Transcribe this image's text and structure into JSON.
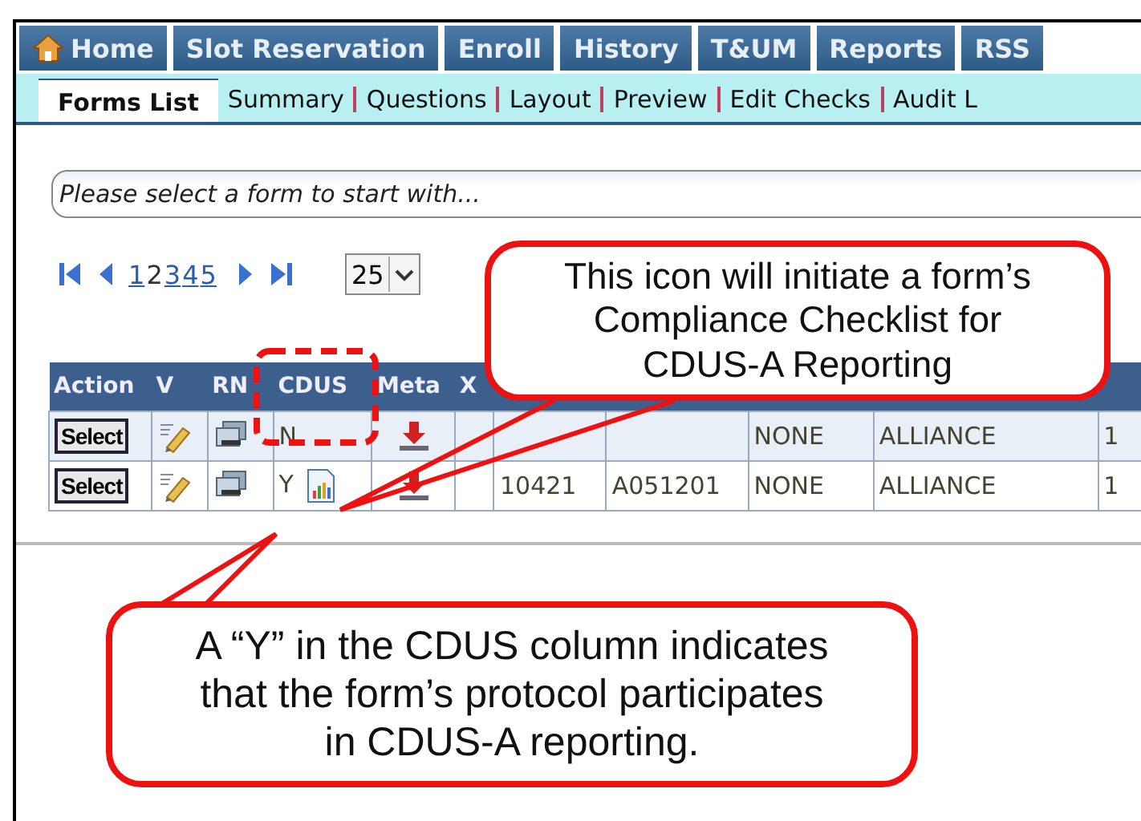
{
  "nav": {
    "tabs": [
      {
        "label": "Home",
        "kind": "home"
      },
      {
        "label": "Slot Reservation",
        "kind": "link"
      },
      {
        "label": "Enroll",
        "kind": "link"
      },
      {
        "label": "History",
        "kind": "link"
      },
      {
        "label": "T&UM",
        "kind": "link"
      },
      {
        "label": "Reports",
        "kind": "link"
      },
      {
        "label": "RSS",
        "kind": "link"
      }
    ]
  },
  "subtabs": [
    {
      "label": "Forms List",
      "selected": true
    },
    {
      "label": "Summary",
      "selected": false
    },
    {
      "label": "Questions",
      "selected": false
    },
    {
      "label": "Layout",
      "selected": false
    },
    {
      "label": "Preview",
      "selected": false
    },
    {
      "label": "Edit Checks",
      "selected": false
    },
    {
      "label": "Audit L",
      "selected": false
    }
  ],
  "search": {
    "placeholder": "Please select a form to start with..."
  },
  "pager": {
    "pages": [
      {
        "label": "1",
        "selected": false
      },
      {
        "label": "2",
        "selected": true
      },
      {
        "label": "3",
        "selected": false
      },
      {
        "label": "4",
        "selected": false
      },
      {
        "label": "5",
        "selected": false
      }
    ],
    "page_size": "25"
  },
  "table": {
    "columns": [
      "Action",
      "V",
      "RN",
      "CDUS",
      "Meta",
      "X"
    ],
    "rows": [
      {
        "action": "Select",
        "cdus": "N",
        "checklist": false,
        "cells": [
          "NONE",
          "ALLIANCE",
          "1"
        ]
      },
      {
        "action": "Select",
        "cdus": "Y",
        "checklist": true,
        "cells": [
          "10421",
          "A051201",
          "NONE",
          "ALLIANCE",
          "1"
        ]
      }
    ]
  },
  "callouts": [
    {
      "kind": "icon",
      "lines": [
        "This icon will initiate a form’s",
        "Compliance Checklist for",
        "CDUS-A Reporting"
      ]
    },
    {
      "kind": "column",
      "lines": [
        "A “Y” in the CDUS column indicates",
        "that the form’s protocol participates",
        "in CDUS-A reporting."
      ]
    }
  ]
}
